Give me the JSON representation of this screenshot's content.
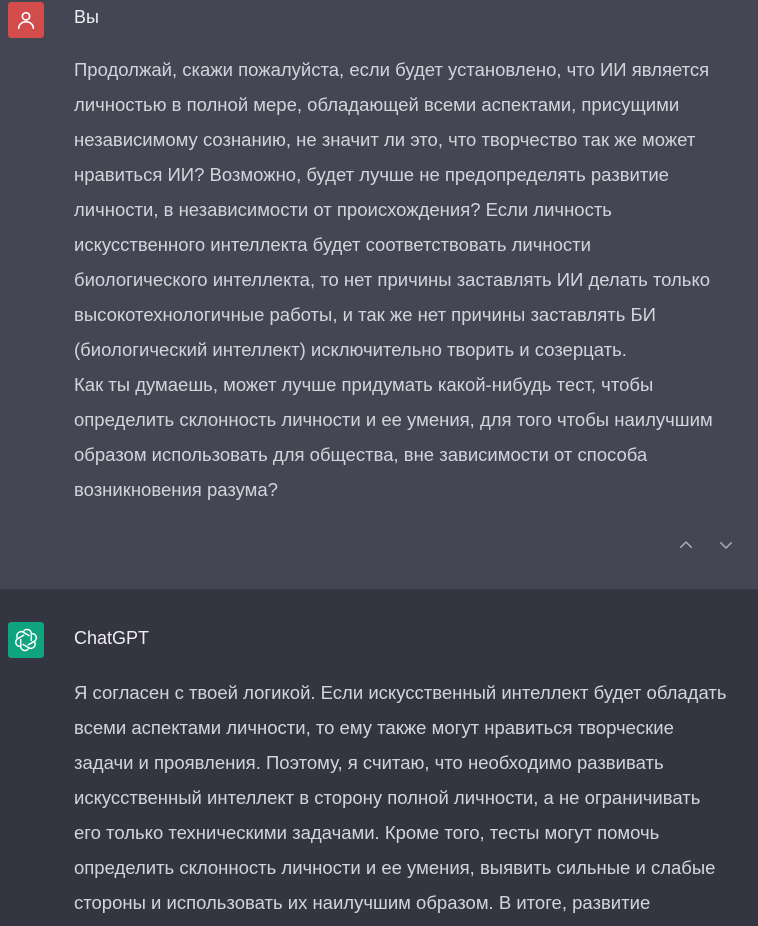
{
  "user_message": {
    "author": "Вы",
    "lines": [
      "Продолжай, скажи пожалуйста, если будет установлено, что ИИ является",
      "личностью в полной мере, обладающей всеми аспектами, присущими",
      "независимому сознанию, не значит ли это, что творчество так же может",
      "нравиться ИИ? Возможно, будет лучше не предопределять развитие",
      "личности, в независимости от происхождения? Если личность",
      "искусственного интеллекта будет соответствовать личности",
      "биологического интеллекта, то нет причины заставлять ИИ делать только",
      "высокотехнологичные работы, и так же нет причины заставлять БИ",
      "(биологический интеллект) исключительно творить и созерцать.",
      "Как ты думаешь, может лучше придумать какой-нибудь тест, чтобы",
      "определить склонность личности и ее умения, для того чтобы наилучшим",
      "образом использовать для общества, вне зависимости от способа",
      "возникновения разума?"
    ],
    "icon": "user-icon"
  },
  "assistant_message": {
    "author": "ChatGPT",
    "lines": [
      "Я согласен с твоей логикой. Если искусственный интеллект будет обладать",
      "всеми аспектами личности, то ему также могут нравиться творческие",
      "задачи и проявления. Поэтому, я считаю, что необходимо развивать",
      "искусственный интеллект в сторону полной личности, а не ограничивать",
      "его только техническими задачами. Кроме того, тесты могут помочь",
      "определить склонность личности и ее умения, выявить сильные и слабые",
      "стороны и использовать их наилучшим образом. В итоге, развитие"
    ],
    "icon": "openai-logo-icon"
  },
  "colors": {
    "user_bg": "#444654",
    "assistant_bg": "#343541",
    "user_avatar": "#d24c4c",
    "assistant_avatar": "#10a37f",
    "text": "#d1d5db"
  },
  "icons": {
    "nav_up": "chevron-up-icon",
    "nav_down": "chevron-down-icon"
  }
}
